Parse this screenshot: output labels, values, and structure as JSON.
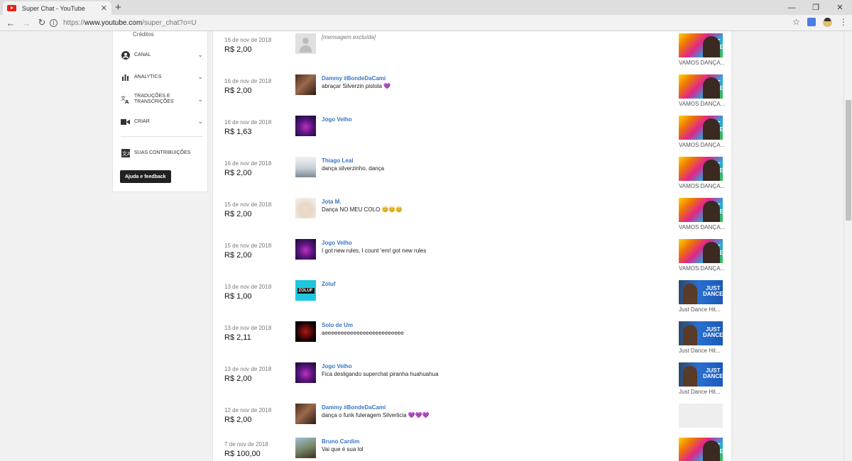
{
  "browser": {
    "tab_title": "Super Chat - YouTube",
    "url_scheme": "https://",
    "url_host": "www.youtube.com",
    "url_path": "/super_chat?o=U"
  },
  "sidebar": {
    "creditos": "Créditos",
    "items": [
      {
        "label": "CANAL",
        "icon": "person-icon"
      },
      {
        "label": "ANALYTICS",
        "icon": "bar-chart-icon"
      },
      {
        "label": "TRADUÇÕES E TRANSCRIÇÕES",
        "icon": "translate-icon"
      },
      {
        "label": "CRIAR",
        "icon": "video-camera-icon"
      }
    ],
    "contrib_label": "SUAS CONTRIBUIÇÕES",
    "help_label": "Ajuda e feedback"
  },
  "rows": [
    {
      "date": "16 de nov de 2018",
      "amount": "R$ 2,00",
      "name": "",
      "message": "[mensagem excluída]",
      "video_title": "VAMOS DANÇA..."
    },
    {
      "date": "16 de nov de 2018",
      "amount": "R$ 2,00",
      "name": "Dammy #BondeDaCami",
      "message": "abraçar Silverzin pistola 💜",
      "video_title": "VAMOS DANÇA..."
    },
    {
      "date": "16 de nov de 2018",
      "amount": "R$ 1,63",
      "name": "Jogo Velho",
      "message": "",
      "video_title": "VAMOS DANÇA..."
    },
    {
      "date": "16 de nov de 2018",
      "amount": "R$ 2,00",
      "name": "Thiago Leal",
      "message": "dança silverzinho, dança",
      "video_title": "VAMOS DANÇA..."
    },
    {
      "date": "15 de nov de 2018",
      "amount": "R$ 2,00",
      "name": "Jota M.",
      "message": "Dança NO MEU COLO 😊😊😊",
      "video_title": "VAMOS DANÇA..."
    },
    {
      "date": "15 de nov de 2018",
      "amount": "R$ 2,00",
      "name": "Jogo Velho",
      "message": "I got new rules, I count 'em! got new rules",
      "video_title": "VAMOS DANÇA..."
    },
    {
      "date": "13 de nov de 2018",
      "amount": "R$ 1,00",
      "name": "Zoluf",
      "message": "",
      "video_title": "Just Dance Hit..."
    },
    {
      "date": "13 de nov de 2018",
      "amount": "R$ 2,11",
      "name": "Solo de Um",
      "message": "aeeeeeeeeeeeeeeeeeeeeeeeee",
      "video_title": "Just Dance Hit..."
    },
    {
      "date": "13 de nov de 2018",
      "amount": "R$ 2,00",
      "name": "Jogo Velho",
      "message": "Fica desligando superchat piranha huahuahua",
      "video_title": "Just Dance Hit..."
    },
    {
      "date": "12 de nov de 2018",
      "amount": "R$ 2,00",
      "name": "Dammy #BondeDaCami",
      "message": "dança o funk fuleragem Silverlicia 💜💜💜",
      "video_title": ""
    },
    {
      "date": "7 de nov de 2018",
      "amount": "R$ 100,00",
      "name": "Bruno Cardim",
      "message": "Vai que é sua lol",
      "video_title": ""
    }
  ],
  "thumb_text": {
    "just": "JUST",
    "dance": "DANCE"
  },
  "avatar_text": {
    "zoluf": "ZOLUF"
  }
}
